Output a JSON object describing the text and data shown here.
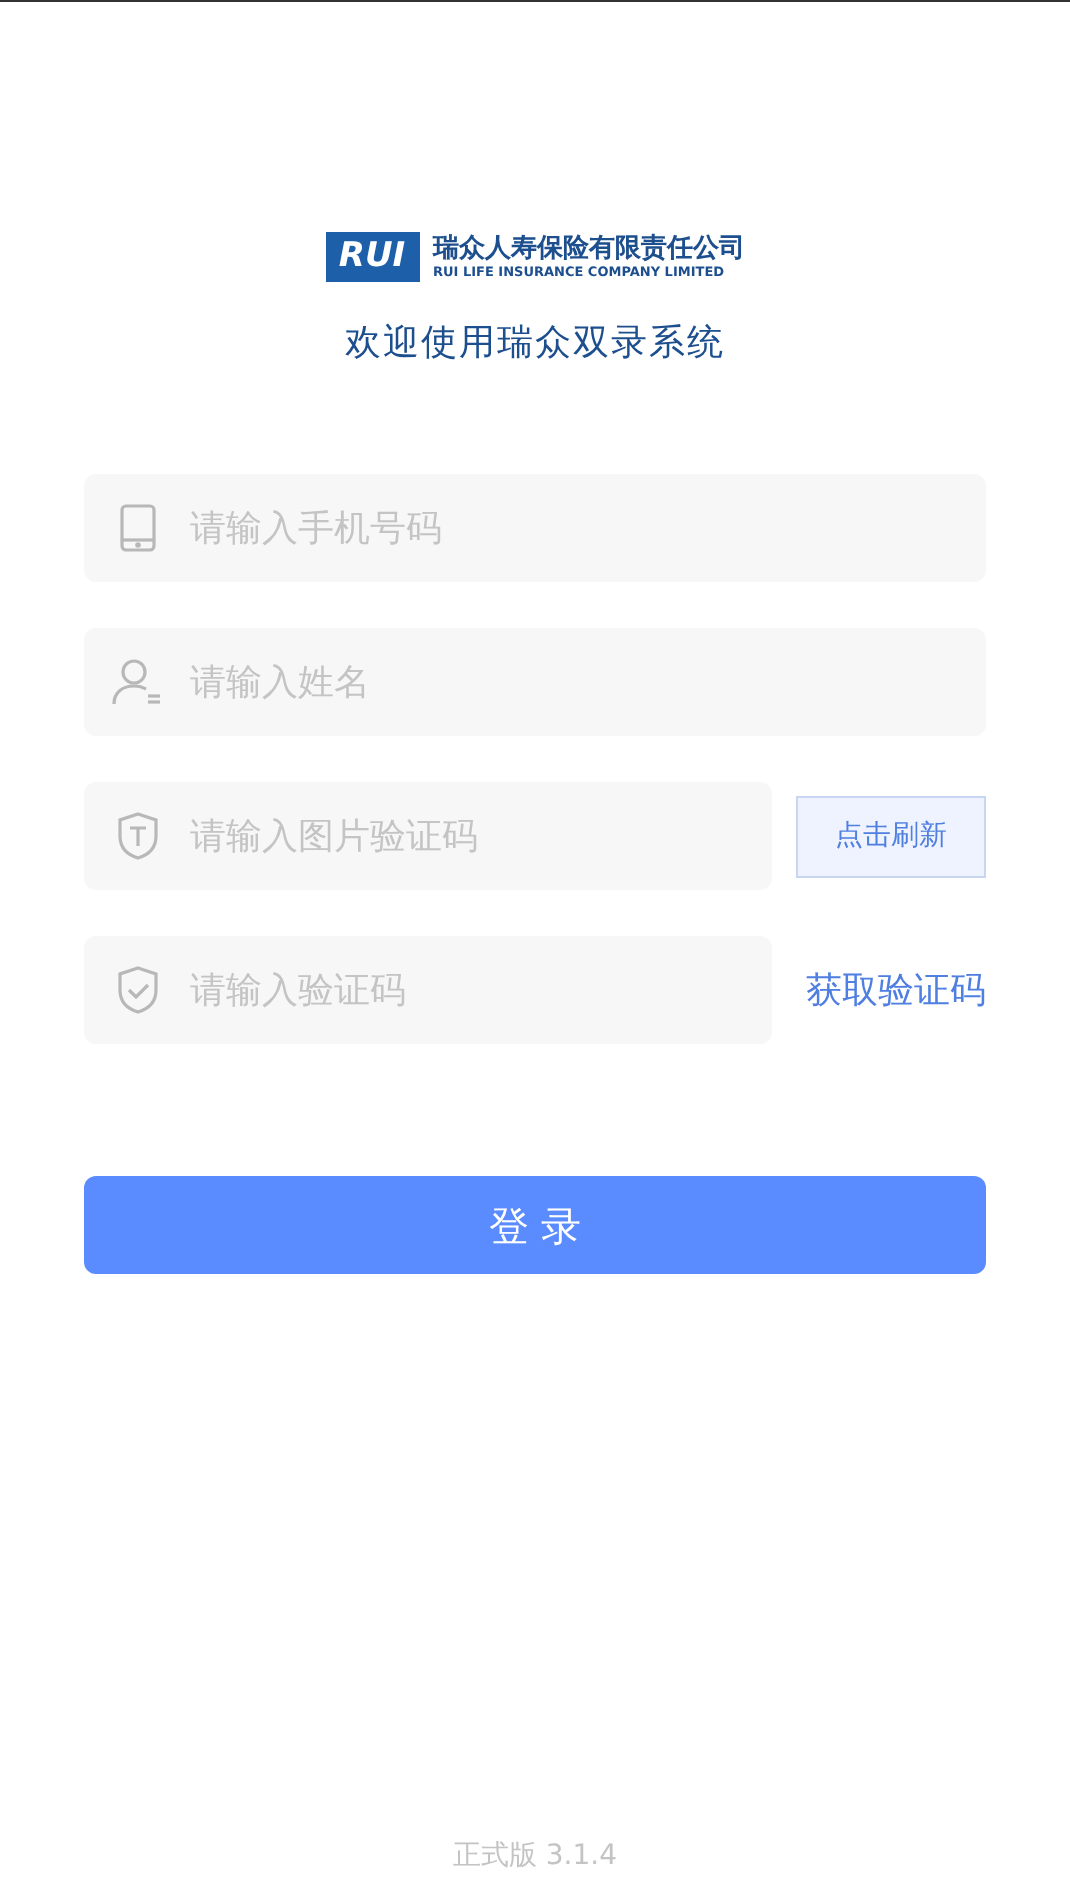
{
  "logo": {
    "mark": "RUI",
    "name_cn": "瑞众人寿保险有限责任公司",
    "name_en": "RUI LIFE INSURANCE COMPANY LIMITED"
  },
  "welcome": "欢迎使用瑞众双录系统",
  "fields": [
    {
      "kind": "phone",
      "placeholder": "请输入手机号码"
    },
    {
      "kind": "name",
      "placeholder": "请输入姓名"
    },
    {
      "kind": "captcha",
      "placeholder": "请输入图片验证码",
      "action": "点击刷新"
    },
    {
      "kind": "sms",
      "placeholder": "请输入验证码",
      "action": "获取验证码"
    }
  ],
  "login_button": "登 录",
  "version": "正式版 3.1.4"
}
